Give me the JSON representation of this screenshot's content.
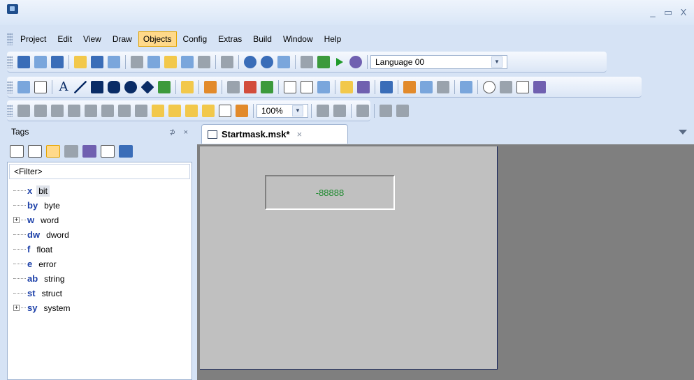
{
  "window": {
    "controls": {
      "minimize": "_",
      "maximize": "▭",
      "close": "X"
    }
  },
  "menu": {
    "items": [
      "Project",
      "Edit",
      "View",
      "Draw",
      "Objects",
      "Config",
      "Extras",
      "Build",
      "Window",
      "Help"
    ],
    "active": "Objects"
  },
  "toolbar1": {
    "language_select": "Language 00"
  },
  "toolbar2": {
    "text_tool": "A"
  },
  "toolbar3": {
    "zoom_level": "100%"
  },
  "tags_panel": {
    "title": "Tags",
    "pin": "⊅",
    "close": "×",
    "filter_text": "<Filter>",
    "tree": [
      {
        "code": "x",
        "name": "bit",
        "expandable": false,
        "selected": true
      },
      {
        "code": "by",
        "name": "byte",
        "expandable": false,
        "selected": false
      },
      {
        "code": "w",
        "name": "word",
        "expandable": true,
        "selected": false
      },
      {
        "code": "dw",
        "name": "dword",
        "expandable": false,
        "selected": false
      },
      {
        "code": "f",
        "name": "float",
        "expandable": false,
        "selected": false
      },
      {
        "code": "e",
        "name": "error",
        "expandable": false,
        "selected": false
      },
      {
        "code": "ab",
        "name": "string",
        "expandable": false,
        "selected": false
      },
      {
        "code": "st",
        "name": "struct",
        "expandable": false,
        "selected": false
      },
      {
        "code": "sy",
        "name": "system",
        "expandable": true,
        "selected": false
      }
    ],
    "expander_glyph": "+"
  },
  "document": {
    "tab_title": "Startmask.msk*",
    "tab_close": "×",
    "numeric_field_value": "-88888"
  },
  "colors": {
    "accent": "#ffd98a",
    "canvas_bg": "#c0c0c0",
    "workspace_bg": "#7f7f7f",
    "value_text": "#1d8a2e"
  }
}
